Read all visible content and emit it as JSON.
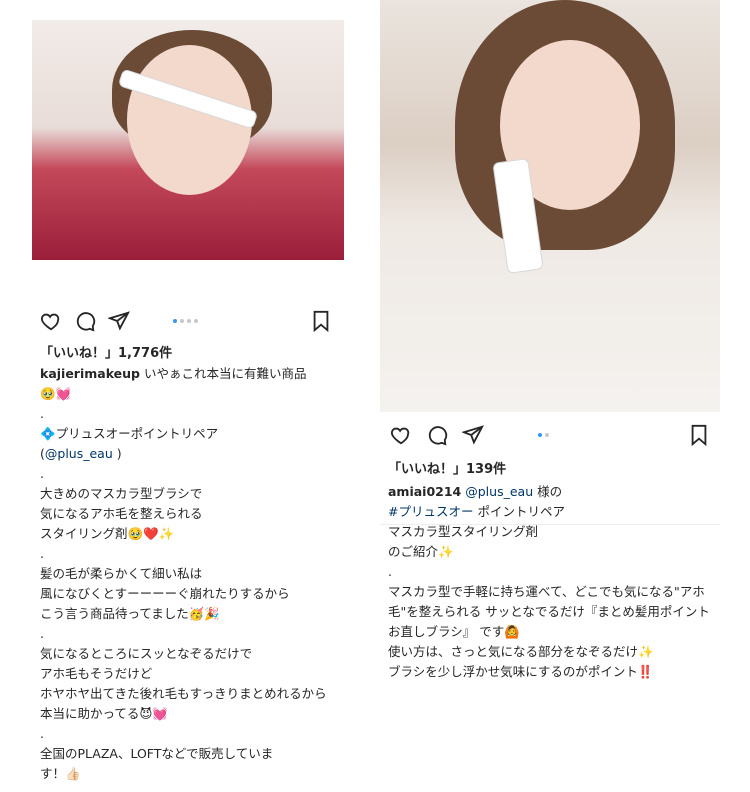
{
  "left_post": {
    "likes": "「いいね！」1,776件",
    "username": "kajierimakeup",
    "caption_first": " いやぁこれ本当に有難い商品\n🥹💓\n.\n💠プリュスオーポイントリペア\n(",
    "mention": "@plus_eau",
    "caption_rest": " )\n.\n大きめのマスカラ型ブラシで\n気になるアホ毛を整えられる\nスタイリング剤🥹❤️✨\n.\n髪の毛が柔らかくて細い私は\n風になびくとすーーーーぐ崩れたりするから\nこう言う商品待ってました🥳🎉\n.\n気になるところにスッとなぞるだけで\nアホ毛もそうだけど\nホヤホヤ出てきた後れ毛もすっきりまとめれるから\n本当に助かってる😈💓\n.\n全国のPLAZA、LOFTなどで販売していま\nす！👍🏻"
  },
  "right_post": {
    "likes": "「いいね！」139件",
    "username": "amiai0214",
    "mention": "@plus_eau",
    "sama": " 様の",
    "hashtag": "#プリュスオー",
    "caption_rest": " ポイントリペア\nマスカラ型スタイリング剤\nのご紹介✨\n.\nマスカラ型で手軽に持ち運べて、どこでも気になる\"アホ毛\"を整えられる サッとなでるだけ『まとめ髪用ポイントお直しブラシ』 です🙆\n使い方は、さっと気になる部分をなぞるだけ✨\nブラシを少し浮かせ気味にするのがポイント‼️"
  },
  "icons": {
    "like": "heart-icon",
    "comment": "comment-icon",
    "share": "paper-plane-icon",
    "save": "bookmark-icon"
  },
  "colors": {
    "carousel_active": "#3897f0",
    "carousel_inactive": "#c8c8c8",
    "hashtag": "#003569"
  }
}
